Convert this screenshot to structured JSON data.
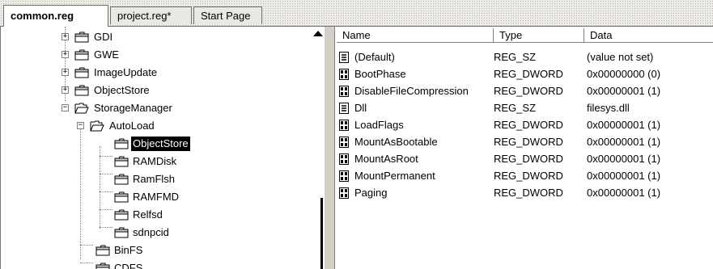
{
  "tabs": [
    {
      "label": "common.reg",
      "active": true
    },
    {
      "label": "project.reg*",
      "active": false
    },
    {
      "label": "Start Page",
      "active": false
    }
  ],
  "tree": {
    "items": [
      {
        "label": "GDI",
        "expander": "+",
        "open": false
      },
      {
        "label": "GWE",
        "expander": "+",
        "open": false
      },
      {
        "label": "ImageUpdate",
        "expander": "+",
        "open": false
      },
      {
        "label": "ObjectStore",
        "expander": "+",
        "open": false
      },
      {
        "label": "StorageManager",
        "expander": "−",
        "open": true
      },
      {
        "label": "AutoLoad",
        "expander": "−",
        "open": true
      },
      {
        "label": "ObjectStore",
        "selected": true
      },
      {
        "label": "RAMDisk"
      },
      {
        "label": "RamFlsh"
      },
      {
        "label": "RAMFMD"
      },
      {
        "label": "Relfsd"
      },
      {
        "label": "sdnpcid"
      },
      {
        "label": "BinFS"
      },
      {
        "label": "CDFS"
      }
    ]
  },
  "list": {
    "columns": [
      "Name",
      "Type",
      "Data"
    ],
    "rows": [
      {
        "name": "(Default)",
        "type": "REG_SZ",
        "data": "(value not set)",
        "icon": "string-value-icon"
      },
      {
        "name": "BootPhase",
        "type": "REG_DWORD",
        "data": "0x00000000 (0)",
        "icon": "binary-value-icon"
      },
      {
        "name": "DisableFileCompression",
        "type": "REG_DWORD",
        "data": "0x00000001 (1)",
        "icon": "binary-value-icon"
      },
      {
        "name": "Dll",
        "type": "REG_SZ",
        "data": "filesys.dll",
        "icon": "string-value-icon"
      },
      {
        "name": "LoadFlags",
        "type": "REG_DWORD",
        "data": "0x00000001 (1)",
        "icon": "binary-value-icon"
      },
      {
        "name": "MountAsBootable",
        "type": "REG_DWORD",
        "data": "0x00000001 (1)",
        "icon": "binary-value-icon"
      },
      {
        "name": "MountAsRoot",
        "type": "REG_DWORD",
        "data": "0x00000001 (1)",
        "icon": "binary-value-icon"
      },
      {
        "name": "MountPermanent",
        "type": "REG_DWORD",
        "data": "0x00000001 (1)",
        "icon": "binary-value-icon"
      },
      {
        "name": "Paging",
        "type": "REG_DWORD",
        "data": "0x00000001 (1)",
        "icon": "binary-value-icon"
      }
    ]
  }
}
